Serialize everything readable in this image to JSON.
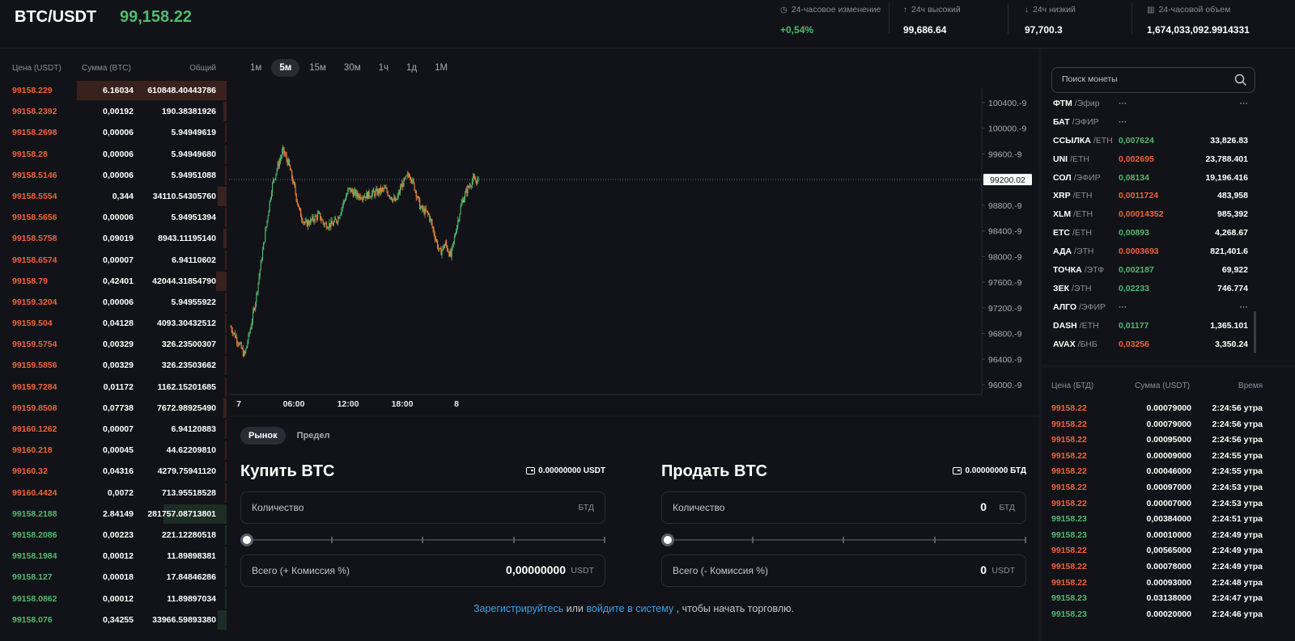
{
  "header": {
    "pair": "BTC/USDT",
    "last_price": "99,158.22",
    "stats": [
      {
        "label": "24-часовое изменение",
        "value": "+0,54%",
        "icon": "clock-icon",
        "glyph": "◷",
        "value_color": "green"
      },
      {
        "label": "24ч высокий",
        "value": "99,686.64",
        "icon": "arrow-up-icon",
        "glyph": "↑",
        "value_color": "white"
      },
      {
        "label": "24ч низкий",
        "value": "97,700.3",
        "icon": "arrow-down-icon",
        "glyph": "↓",
        "value_color": "white"
      },
      {
        "label": "24-часовой объем",
        "value": "1,674,033,092.9914331",
        "icon": "bar-chart-icon",
        "glyph": "▥",
        "value_color": "white"
      }
    ]
  },
  "orderbook": {
    "columns": [
      "Цена (USDT)",
      "Сумма (BTC)",
      "Общий"
    ],
    "rows": [
      {
        "price": "99158.229",
        "amount": "6.16034",
        "total": "610848.40443786",
        "side": "ask",
        "depth": 1.0
      },
      {
        "price": "99158.2392",
        "amount": "0,00192",
        "total": "190.38381926",
        "side": "ask",
        "depth": 0.02
      },
      {
        "price": "99158.2698",
        "amount": "0,00006",
        "total": "5.94949619",
        "side": "ask",
        "depth": 0.01
      },
      {
        "price": "99158.28",
        "amount": "0,00006",
        "total": "5.94949680",
        "side": "ask",
        "depth": 0.01
      },
      {
        "price": "99158.5146",
        "amount": "0,00006",
        "total": "5.94951088",
        "side": "ask",
        "depth": 0.01
      },
      {
        "price": "99158.5554",
        "amount": "0,344",
        "total": "34110.54305760",
        "side": "ask",
        "depth": 0.06
      },
      {
        "price": "99158.5656",
        "amount": "0,00006",
        "total": "5.94951394",
        "side": "ask",
        "depth": 0.01
      },
      {
        "price": "99158.5758",
        "amount": "0,09019",
        "total": "8943.11195140",
        "side": "ask",
        "depth": 0.02
      },
      {
        "price": "99158.6574",
        "amount": "0,00007",
        "total": "6.94110602",
        "side": "ask",
        "depth": 0.01
      },
      {
        "price": "99158.79",
        "amount": "0,42401",
        "total": "42044.31854790",
        "side": "ask",
        "depth": 0.07
      },
      {
        "price": "99159.3204",
        "amount": "0,00006",
        "total": "5.94955922",
        "side": "ask",
        "depth": 0.01
      },
      {
        "price": "99159.504",
        "amount": "0,04128",
        "total": "4093.30432512",
        "side": "ask",
        "depth": 0.01
      },
      {
        "price": "99159.5754",
        "amount": "0,00329",
        "total": "326.23500307",
        "side": "ask",
        "depth": 0.01
      },
      {
        "price": "99159.5856",
        "amount": "0,00329",
        "total": "326.23503662",
        "side": "ask",
        "depth": 0.01
      },
      {
        "price": "99159.7284",
        "amount": "0,01172",
        "total": "1162.15201685",
        "side": "ask",
        "depth": 0.01
      },
      {
        "price": "99159.8508",
        "amount": "0,07738",
        "total": "7672.98925490",
        "side": "ask",
        "depth": 0.02
      },
      {
        "price": "99160.1262",
        "amount": "0,00007",
        "total": "6.94120883",
        "side": "ask",
        "depth": 0.01
      },
      {
        "price": "99160.218",
        "amount": "0,00045",
        "total": "44.62209810",
        "side": "ask",
        "depth": 0.01
      },
      {
        "price": "99160.32",
        "amount": "0,04316",
        "total": "4279.75941120",
        "side": "ask",
        "depth": 0.01
      },
      {
        "price": "99160.4424",
        "amount": "0,0072",
        "total": "713.95518528",
        "side": "ask",
        "depth": 0.01
      },
      {
        "price": "99158.2188",
        "amount": "2.84149",
        "total": "281757.08713801",
        "side": "bid",
        "depth": 0.42
      },
      {
        "price": "99158.2086",
        "amount": "0,00223",
        "total": "221.12280518",
        "side": "bid",
        "depth": 0.01
      },
      {
        "price": "99158.1984",
        "amount": "0,00012",
        "total": "11.89898381",
        "side": "bid",
        "depth": 0.01
      },
      {
        "price": "99158.127",
        "amount": "0,00018",
        "total": "17.84846286",
        "side": "bid",
        "depth": 0.01
      },
      {
        "price": "99158.0862",
        "amount": "0,00012",
        "total": "11.89897034",
        "side": "bid",
        "depth": 0.01
      },
      {
        "price": "99158.076",
        "amount": "0,34255",
        "total": "33966.59893380",
        "side": "bid",
        "depth": 0.06
      }
    ]
  },
  "chart": {
    "timeframes": [
      "1м",
      "5м",
      "15м",
      "30м",
      "1ч",
      "1д",
      "1М"
    ],
    "active_timeframe": "5м",
    "current_price_label": "99200.02"
  },
  "chart_data": {
    "type": "candlestick",
    "price_axis": [
      "100400.-9",
      "100000.-9",
      "99600.-9",
      "99200.-9",
      "98800.-9",
      "98400.-9",
      "98000.-9",
      "97600.-9",
      "97200.-9",
      "96800.-9",
      "96400.-9",
      "96000.-9"
    ],
    "time_axis": [
      "7",
      "06:00",
      "12:00",
      "18:00",
      "8"
    ],
    "ylim": [
      96000,
      100400
    ],
    "current_price": 99200.02,
    "colors": {
      "up": "#52b96f",
      "down": "#f0873a"
    },
    "path": [
      [
        0,
        96900
      ],
      [
        3,
        96650
      ],
      [
        5,
        96450
      ],
      [
        7,
        96850
      ],
      [
        9,
        97300
      ],
      [
        11,
        97900
      ],
      [
        13,
        98500
      ],
      [
        15,
        99100
      ],
      [
        17,
        99400
      ],
      [
        19,
        99650
      ],
      [
        20,
        99550
      ],
      [
        21,
        99450
      ],
      [
        23,
        99100
      ],
      [
        25,
        98700
      ],
      [
        27,
        98500
      ],
      [
        29,
        98550
      ],
      [
        32,
        98650
      ],
      [
        34,
        98500
      ],
      [
        37,
        98500
      ],
      [
        39,
        98600
      ],
      [
        41,
        98850
      ],
      [
        43,
        99050
      ],
      [
        46,
        98950
      ],
      [
        49,
        98950
      ],
      [
        53,
        99000
      ],
      [
        56,
        99050
      ],
      [
        60,
        98850
      ],
      [
        62,
        99100
      ],
      [
        65,
        99300
      ],
      [
        67,
        99050
      ],
      [
        69,
        98750
      ],
      [
        72,
        98650
      ],
      [
        74,
        98350
      ],
      [
        76,
        98050
      ],
      [
        78,
        98200
      ],
      [
        80,
        98000
      ],
      [
        82,
        98450
      ],
      [
        84,
        98850
      ],
      [
        86,
        99050
      ],
      [
        88,
        99200
      ],
      [
        90,
        99180
      ]
    ],
    "x_span": 90
  },
  "trade": {
    "order_types": [
      "Рынок",
      "Предел"
    ],
    "active_order_type": "Рынок",
    "buy": {
      "title": "Купить BTC",
      "balance": "0.00000000 USDT",
      "qty_label": "Количество",
      "qty_value": "",
      "qty_unit": "БТД",
      "total_label": "Всего (+ Комиссия %)",
      "total_value": "0,00000000",
      "total_unit": "USDT"
    },
    "sell": {
      "title": "Продать BTC",
      "balance": "0.00000000 БТД",
      "qty_label": "Количество",
      "qty_value": "0",
      "qty_unit": "БТД",
      "total_label": "Всего (- Комиссия %)",
      "total_value": "0",
      "total_unit": "USDT"
    },
    "signup": {
      "register": "Зарегистрируйтесь",
      "or": "или",
      "login": "войдите в систему",
      "rest": ", чтобы начать торговлю."
    }
  },
  "markets": {
    "search_placeholder": "Поиск монеты",
    "rows": [
      {
        "base": "ФТМ",
        "quote": "/Эфир",
        "price": "···",
        "volume": "···",
        "color": "gray"
      },
      {
        "base": "БАТ",
        "quote": "/ЭФИР",
        "price": "···",
        "volume": "",
        "color": "gray"
      },
      {
        "base": "ССЫЛКА",
        "quote": "/ETH",
        "price": "0,007624",
        "volume": "33,826.83",
        "color": "green"
      },
      {
        "base": "UNI",
        "quote": "/ETH",
        "price": "0,002695",
        "volume": "23,788.401",
        "color": "red"
      },
      {
        "base": "СОЛ",
        "quote": "/ЭФИР",
        "price": "0,08134",
        "volume": "19,196.416",
        "color": "green"
      },
      {
        "base": "XRP",
        "quote": "/ETH",
        "price": "0,0011724",
        "volume": "483,958",
        "color": "red"
      },
      {
        "base": "XLM",
        "quote": "/ETH",
        "price": "0,00014352",
        "volume": "985,392",
        "color": "red"
      },
      {
        "base": "ETC",
        "quote": "/ETH",
        "price": "0,00893",
        "volume": "4,268.67",
        "color": "green"
      },
      {
        "base": "АДА",
        "quote": "/ЭТН",
        "price": "0.0003693",
        "volume": "821,401.6",
        "color": "red"
      },
      {
        "base": "ТОЧКА",
        "quote": "/ЭТФ",
        "price": "0,002187",
        "volume": "69,922",
        "color": "green"
      },
      {
        "base": "ЗЕК",
        "quote": "/ЭТН",
        "price": "0,02233",
        "volume": "746.774",
        "color": "green"
      },
      {
        "base": "АЛГО",
        "quote": "/ЭФИР",
        "price": "···",
        "volume": "···",
        "color": "gray"
      },
      {
        "base": "DASH",
        "quote": "/ETH",
        "price": "0,01177",
        "volume": "1,365.101",
        "color": "green"
      },
      {
        "base": "AVAX",
        "quote": "/БНБ",
        "price": "0,03256",
        "volume": "3,350.24",
        "color": "red"
      }
    ]
  },
  "trades": {
    "columns": [
      "Цена (БТД)",
      "Сумма (USDT)",
      "Время"
    ],
    "rows": [
      {
        "price": "99158.22",
        "amount": "0.00079000",
        "time": "2:24:56 утра",
        "side": "red"
      },
      {
        "price": "99158.22",
        "amount": "0.00079000",
        "time": "2:24:56 утра",
        "side": "red"
      },
      {
        "price": "99158.22",
        "amount": "0.00095000",
        "time": "2:24:56 утра",
        "side": "red"
      },
      {
        "price": "99158.22",
        "amount": "0.00009000",
        "time": "2:24:55 утра",
        "side": "red"
      },
      {
        "price": "99158.22",
        "amount": "0.00046000",
        "time": "2:24:55 утра",
        "side": "red"
      },
      {
        "price": "99158.22",
        "amount": "0.00097000",
        "time": "2:24:53 утра",
        "side": "red"
      },
      {
        "price": "99158.22",
        "amount": "0.00007000",
        "time": "2:24:53 утра",
        "side": "red"
      },
      {
        "price": "99158.23",
        "amount": "0,00384000",
        "time": "2:24:51 утра",
        "side": "green"
      },
      {
        "price": "99158.23",
        "amount": "0.00010000",
        "time": "2:24:49 утра",
        "side": "green"
      },
      {
        "price": "99158.22",
        "amount": "0,00565000",
        "time": "2:24:49 утра",
        "side": "red"
      },
      {
        "price": "99158.22",
        "amount": "0.00078000",
        "time": "2:24:49 утра",
        "side": "red"
      },
      {
        "price": "99158.22",
        "amount": "0.00093000",
        "time": "2:24:48 утра",
        "side": "red"
      },
      {
        "price": "99158.23",
        "amount": "0.03138000",
        "time": "2:24:47 утра",
        "side": "green"
      },
      {
        "price": "99158.23",
        "amount": "0.00020000",
        "time": "2:24:46 утра",
        "side": "green"
      }
    ]
  }
}
